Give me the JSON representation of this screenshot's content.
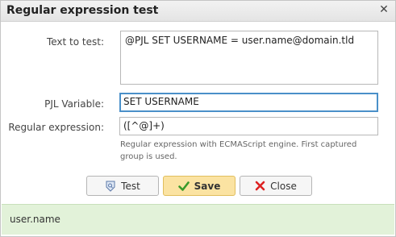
{
  "dialog": {
    "title": "Regular expression test"
  },
  "form": {
    "text_label": "Text to test:",
    "text_value": "@PJL SET USERNAME = user.name@domain.tld",
    "pjl_label": "PJL Variable:",
    "pjl_value": "SET USERNAME",
    "regex_label": "Regular expression:",
    "regex_value": "([^@]+)",
    "regex_hint": "Regular expression with ECMAScript engine. First captured group is used."
  },
  "buttons": {
    "test_label": "Test",
    "save_label": "Save",
    "close_label": "Close"
  },
  "result": {
    "value": "user.name"
  },
  "colors": {
    "result_background": "#e2f2d9",
    "save_button": "#fbe3a2",
    "focus_border": "#4a90c9"
  }
}
